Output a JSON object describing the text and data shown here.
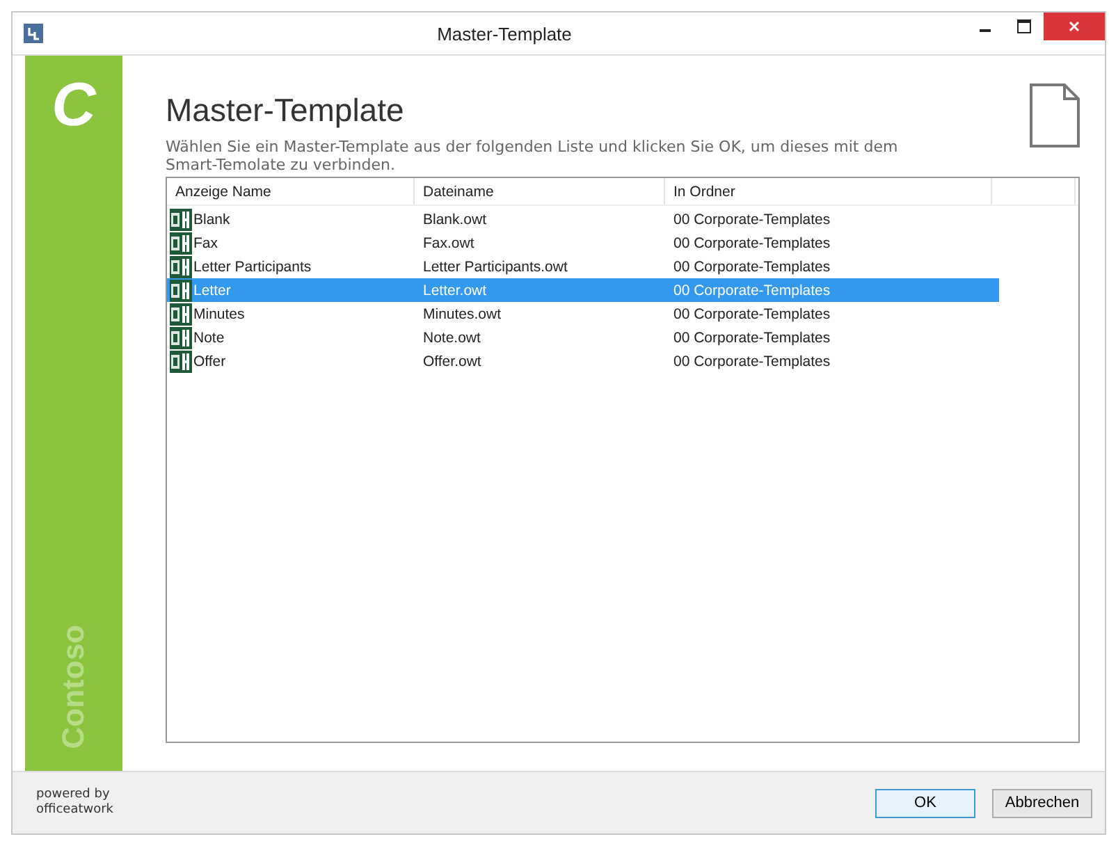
{
  "window": {
    "title": "Master-Template"
  },
  "sidebar": {
    "logo_letter": "C",
    "brand": "Contoso"
  },
  "heading": "Master-Template",
  "description": "Wählen Sie ein Master-Template aus der folgenden Liste und klicken Sie OK, um dieses mit dem Smart-Temolate zu verbinden.",
  "table": {
    "columns": [
      "Anzeige Name",
      "Dateiname",
      "In Ordner"
    ],
    "rows": [
      {
        "name": "Blank",
        "file": "Blank.owt",
        "folder": "00 Corporate-Templates",
        "selected": false
      },
      {
        "name": "Fax",
        "file": "Fax.owt",
        "folder": "00 Corporate-Templates",
        "selected": false
      },
      {
        "name": "Letter Participants",
        "file": "Letter Participants.owt",
        "folder": "00 Corporate-Templates",
        "selected": false
      },
      {
        "name": "Letter",
        "file": "Letter.owt",
        "folder": "00 Corporate-Templates",
        "selected": true
      },
      {
        "name": "Minutes",
        "file": "Minutes.owt",
        "folder": "00 Corporate-Templates",
        "selected": false
      },
      {
        "name": "Note",
        "file": "Note.owt",
        "folder": "00 Corporate-Templates",
        "selected": false
      },
      {
        "name": "Offer",
        "file": "Offer.owt",
        "folder": "00 Corporate-Templates",
        "selected": false
      }
    ]
  },
  "footer": {
    "powered_by": "powered by\nofficeatwork"
  },
  "buttons": [
    "OK",
    "Abbrechen"
  ]
}
